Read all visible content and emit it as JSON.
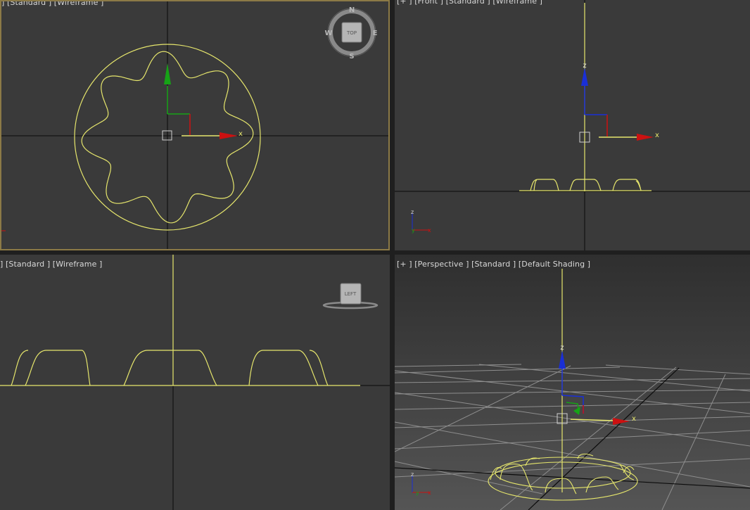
{
  "viewports": {
    "top": {
      "label": "] [Standard ] [Wireframe ]",
      "viewcube": {
        "face": "TOP",
        "n": "N",
        "s": "S",
        "e": "E",
        "w": "W"
      }
    },
    "front": {
      "label": "[+ ] [Front ] [Standard ] [Wireframe ]"
    },
    "left": {
      "label": "] [Standard ] [Wireframe ]",
      "viewcube": {
        "face": "LEFT"
      }
    },
    "perspective": {
      "label": "[+ ] [Perspective ] [Standard ] [Default Shading ]"
    }
  },
  "gizmo_axes": {
    "x": "x",
    "y": "y",
    "z": "z"
  },
  "colors": {
    "viewport_bg": "#3a3a3a",
    "active_border": "#8c7a46",
    "spline": "#e6e66c",
    "axis_x": "#cc1111",
    "axis_y": "#16a316",
    "axis_z": "#1a2fd6",
    "world_axis": "#0b0b0b"
  }
}
